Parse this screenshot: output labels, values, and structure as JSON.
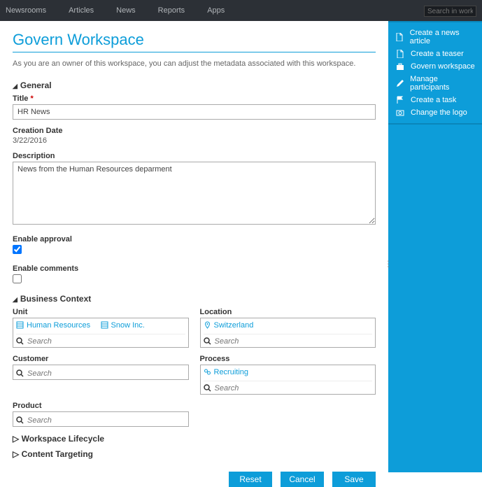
{
  "nav": {
    "items": [
      "Newsrooms",
      "Articles",
      "News",
      "Reports",
      "Apps"
    ],
    "search_placeholder": "Search in workspace"
  },
  "side": {
    "items": [
      {
        "icon": "doc",
        "label": "Create a news article"
      },
      {
        "icon": "doc",
        "label": "Create a teaser"
      },
      {
        "icon": "briefcase",
        "label": "Govern workspace"
      },
      {
        "icon": "pencil",
        "label": "Manage participants"
      },
      {
        "icon": "flag",
        "label": "Create a task"
      },
      {
        "icon": "camera",
        "label": "Change the logo"
      }
    ]
  },
  "page": {
    "title": "Govern Workspace",
    "desc": "As you are an owner of this workspace, you can adjust the metadata associated with this workspace."
  },
  "sections": {
    "general": "General",
    "business": "Business Context",
    "lifecycle": "Workspace Lifecycle",
    "targeting": "Content Targeting"
  },
  "labels": {
    "title": "Title",
    "creation_date": "Creation Date",
    "description": "Description",
    "enable_approval": "Enable approval",
    "enable_comments": "Enable comments",
    "unit": "Unit",
    "location": "Location",
    "customer": "Customer",
    "process": "Process",
    "product": "Product",
    "search": "Search"
  },
  "values": {
    "title": "HR News",
    "creation_date": "3/22/2016",
    "description": "News from the Human Resources deparment",
    "enable_approval": true,
    "enable_comments": false,
    "unit_tags": [
      "Human Resources",
      "Snow Inc."
    ],
    "location_tags": [
      "Switzerland"
    ],
    "process_tags": [
      "Recruiting"
    ]
  },
  "buttons": {
    "reset": "Reset",
    "cancel": "Cancel",
    "save": "Save"
  }
}
